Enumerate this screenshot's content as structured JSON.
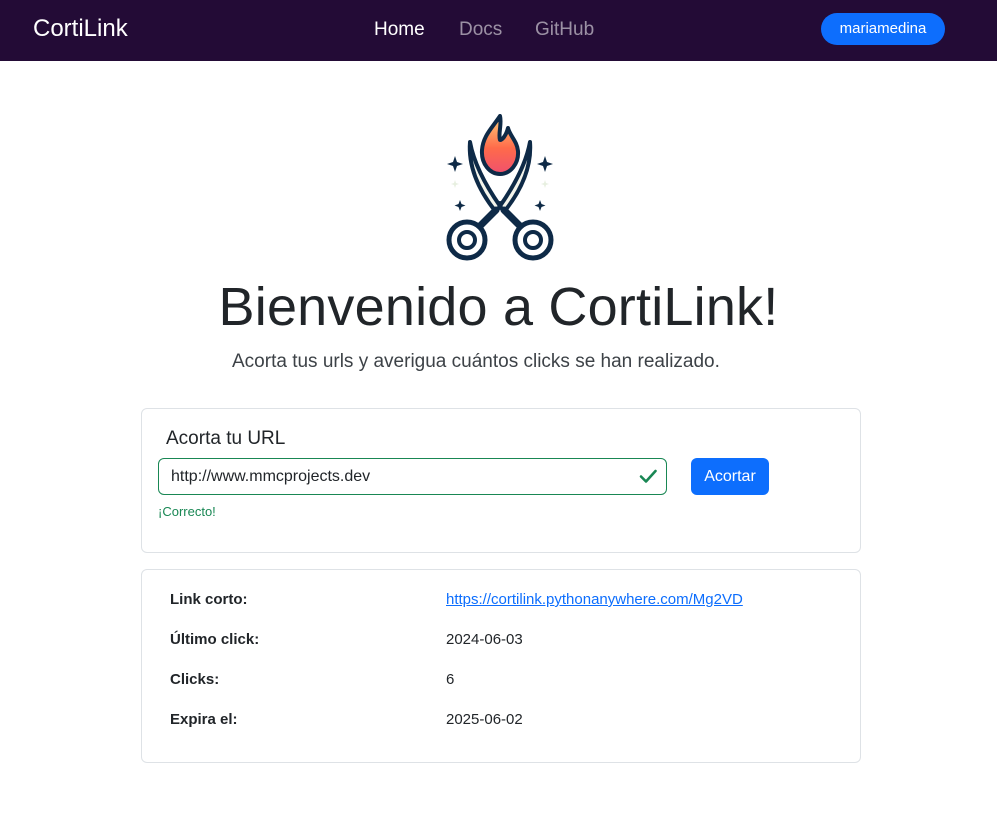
{
  "navbar": {
    "brand": "CortiLink",
    "links": [
      {
        "label": "Home",
        "active": true
      },
      {
        "label": "Docs",
        "active": false
      },
      {
        "label": "GitHub",
        "active": false
      }
    ],
    "user": "mariamedina"
  },
  "hero": {
    "title": "Bienvenido a CortiLink!",
    "subtitle": "Acorta tus urls y averigua cuántos clicks se han realizado."
  },
  "shorten_form": {
    "title": "Acorta tu URL",
    "url_value": "http://www.mmcprojects.dev",
    "valid_message": "¡Correcto!",
    "submit_label": "Acortar"
  },
  "result": {
    "short_link_label": "Link corto:",
    "short_link_value": "https://cortilink.pythonanywhere.com/Mg2VD",
    "last_click_label": "Último click:",
    "last_click_value": "2024-06-03",
    "clicks_label": "Clicks:",
    "clicks_value": "6",
    "expires_label": "Expira el:",
    "expires_value": "2025-06-02"
  },
  "colors": {
    "navbar": "#230b36",
    "primary": "#0d6efd",
    "success": "#198754"
  }
}
